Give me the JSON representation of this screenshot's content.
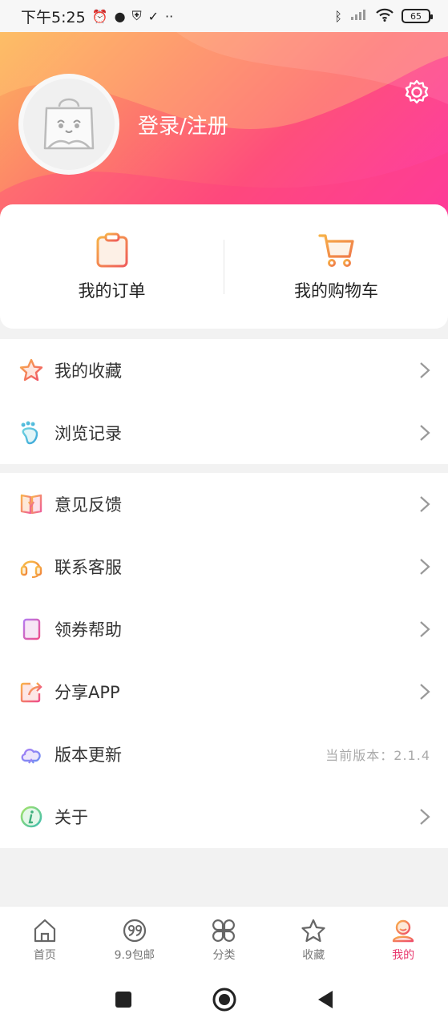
{
  "status_bar": {
    "time": "下午5:25",
    "left_icons": [
      "alarm-off-icon",
      "chat-icon",
      "shield-icon",
      "download-done-icon",
      "more-icon"
    ],
    "right_icons": [
      "bluetooth-icon",
      "signal-icon",
      "wifi-icon"
    ],
    "battery": "65"
  },
  "profile": {
    "login_label": "登录/注册",
    "avatar_icon": "shopping-bag-mascot-icon",
    "settings_icon": "gear-icon"
  },
  "quick_actions": [
    {
      "label": "我的订单",
      "icon": "clipboard-icon"
    },
    {
      "label": "我的购物车",
      "icon": "cart-icon"
    }
  ],
  "menu_group1": [
    {
      "label": "我的收藏",
      "icon": "star-icon"
    },
    {
      "label": "浏览记录",
      "icon": "footprint-icon"
    }
  ],
  "menu_group2": [
    {
      "label": "意见反馈",
      "icon": "feedback-book-icon"
    },
    {
      "label": "联系客服",
      "icon": "headset-icon"
    },
    {
      "label": "领券帮助",
      "icon": "notebook-icon"
    },
    {
      "label": "分享APP",
      "icon": "share-icon"
    },
    {
      "label": "版本更新",
      "icon": "cloud-icon",
      "extra": "当前版本：2.1.4"
    },
    {
      "label": "关于",
      "icon": "info-icon"
    }
  ],
  "tabs": [
    {
      "label": "首页",
      "icon": "home-icon"
    },
    {
      "label": "9.9包邮",
      "icon": "ninety-nine-icon"
    },
    {
      "label": "分类",
      "icon": "category-icon"
    },
    {
      "label": "收藏",
      "icon": "star-outline-icon"
    },
    {
      "label": "我的",
      "icon": "user-icon",
      "active": true
    }
  ],
  "colors": {
    "accent": "#e8356c",
    "header_gradient": [
      "#fcb45d",
      "#fe4f7b",
      "#fd3aa8"
    ]
  }
}
